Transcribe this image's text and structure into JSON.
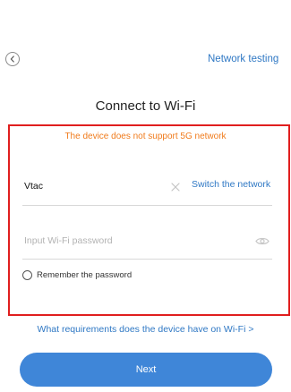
{
  "header": {
    "back_icon": "chevron-left-icon",
    "network_testing_label": "Network testing"
  },
  "title": "Connect to Wi-Fi",
  "warning": "The device does not support 5G network",
  "wifi": {
    "ssid": "Vtac",
    "clear_icon": "close-icon",
    "switch_label": "Switch the network"
  },
  "password": {
    "placeholder": "Input Wi-Fi password",
    "value": "",
    "visibility_icon": "eye-icon"
  },
  "remember": {
    "label": "Remember the password",
    "checked": false
  },
  "requirements_link": "What requirements does the device have on Wi-Fi >",
  "next_button": "Next",
  "colors": {
    "accent": "#3f86d8",
    "link": "#2f78c4",
    "warning": "#f07b1c",
    "highlight_frame": "#e01e1e"
  }
}
